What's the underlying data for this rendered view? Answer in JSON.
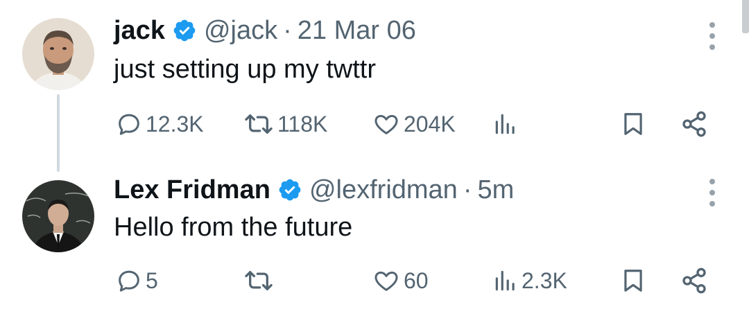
{
  "tweets": [
    {
      "name": "jack",
      "handle": "@jack",
      "separator": "·",
      "time": "21 Mar 06",
      "text": "just setting up my twttr",
      "replies": "12.3K",
      "retweets": "118K",
      "likes": "204K",
      "views": ""
    },
    {
      "name": "Lex Fridman",
      "handle": "@lexfridman",
      "separator": "·",
      "time": "5m",
      "text": "Hello from the future",
      "replies": "5",
      "retweets": "",
      "likes": "60",
      "views": "2.3K"
    }
  ],
  "colors": {
    "text_primary": "#0f1419",
    "text_secondary": "#536471",
    "verified": "#1d9bf0",
    "thread_line": "#cfd9de"
  },
  "icons": [
    "verified-badge-icon",
    "more-icon",
    "reply-icon",
    "retweet-icon",
    "like-icon",
    "views-icon",
    "bookmark-icon",
    "share-icon"
  ]
}
